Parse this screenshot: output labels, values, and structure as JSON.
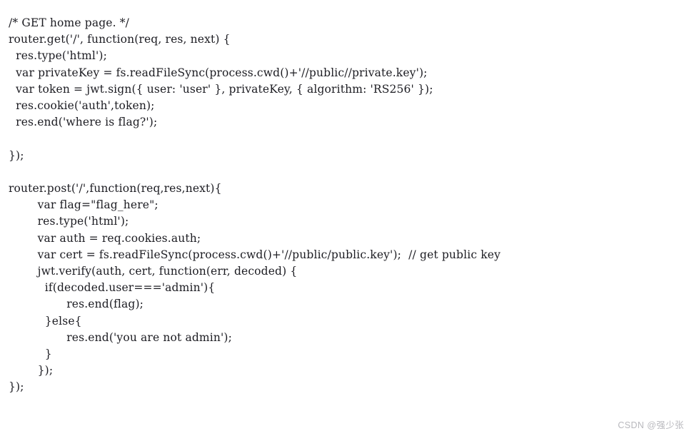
{
  "page": {
    "background_color": "#ffffff",
    "text_color": "#1c1c22",
    "language": "javascript",
    "kind": "source-code-snippet"
  },
  "code": {
    "lines": [
      "/* GET home page. */",
      "router.get('/', function(req, res, next) {",
      "  res.type('html');",
      "  var privateKey = fs.readFileSync(process.cwd()+'//public//private.key');",
      "  var token = jwt.sign({ user: 'user' }, privateKey, { algorithm: 'RS256' });",
      "  res.cookie('auth',token);",
      "  res.end('where is flag?');",
      "",
      "});",
      "",
      "router.post('/',function(req,res,next){",
      "        var flag=\"flag_here\";",
      "        res.type('html');",
      "        var auth = req.cookies.auth;",
      "        var cert = fs.readFileSync(process.cwd()+'//public/public.key');  // get public key",
      "        jwt.verify(auth, cert, function(err, decoded) {",
      "          if(decoded.user==='admin'){",
      "                res.end(flag);",
      "          }else{",
      "                res.end('you are not admin');",
      "          }",
      "        });",
      "});"
    ]
  },
  "watermark": {
    "text": "CSDN @强少张",
    "color": "#b8b8bd"
  }
}
